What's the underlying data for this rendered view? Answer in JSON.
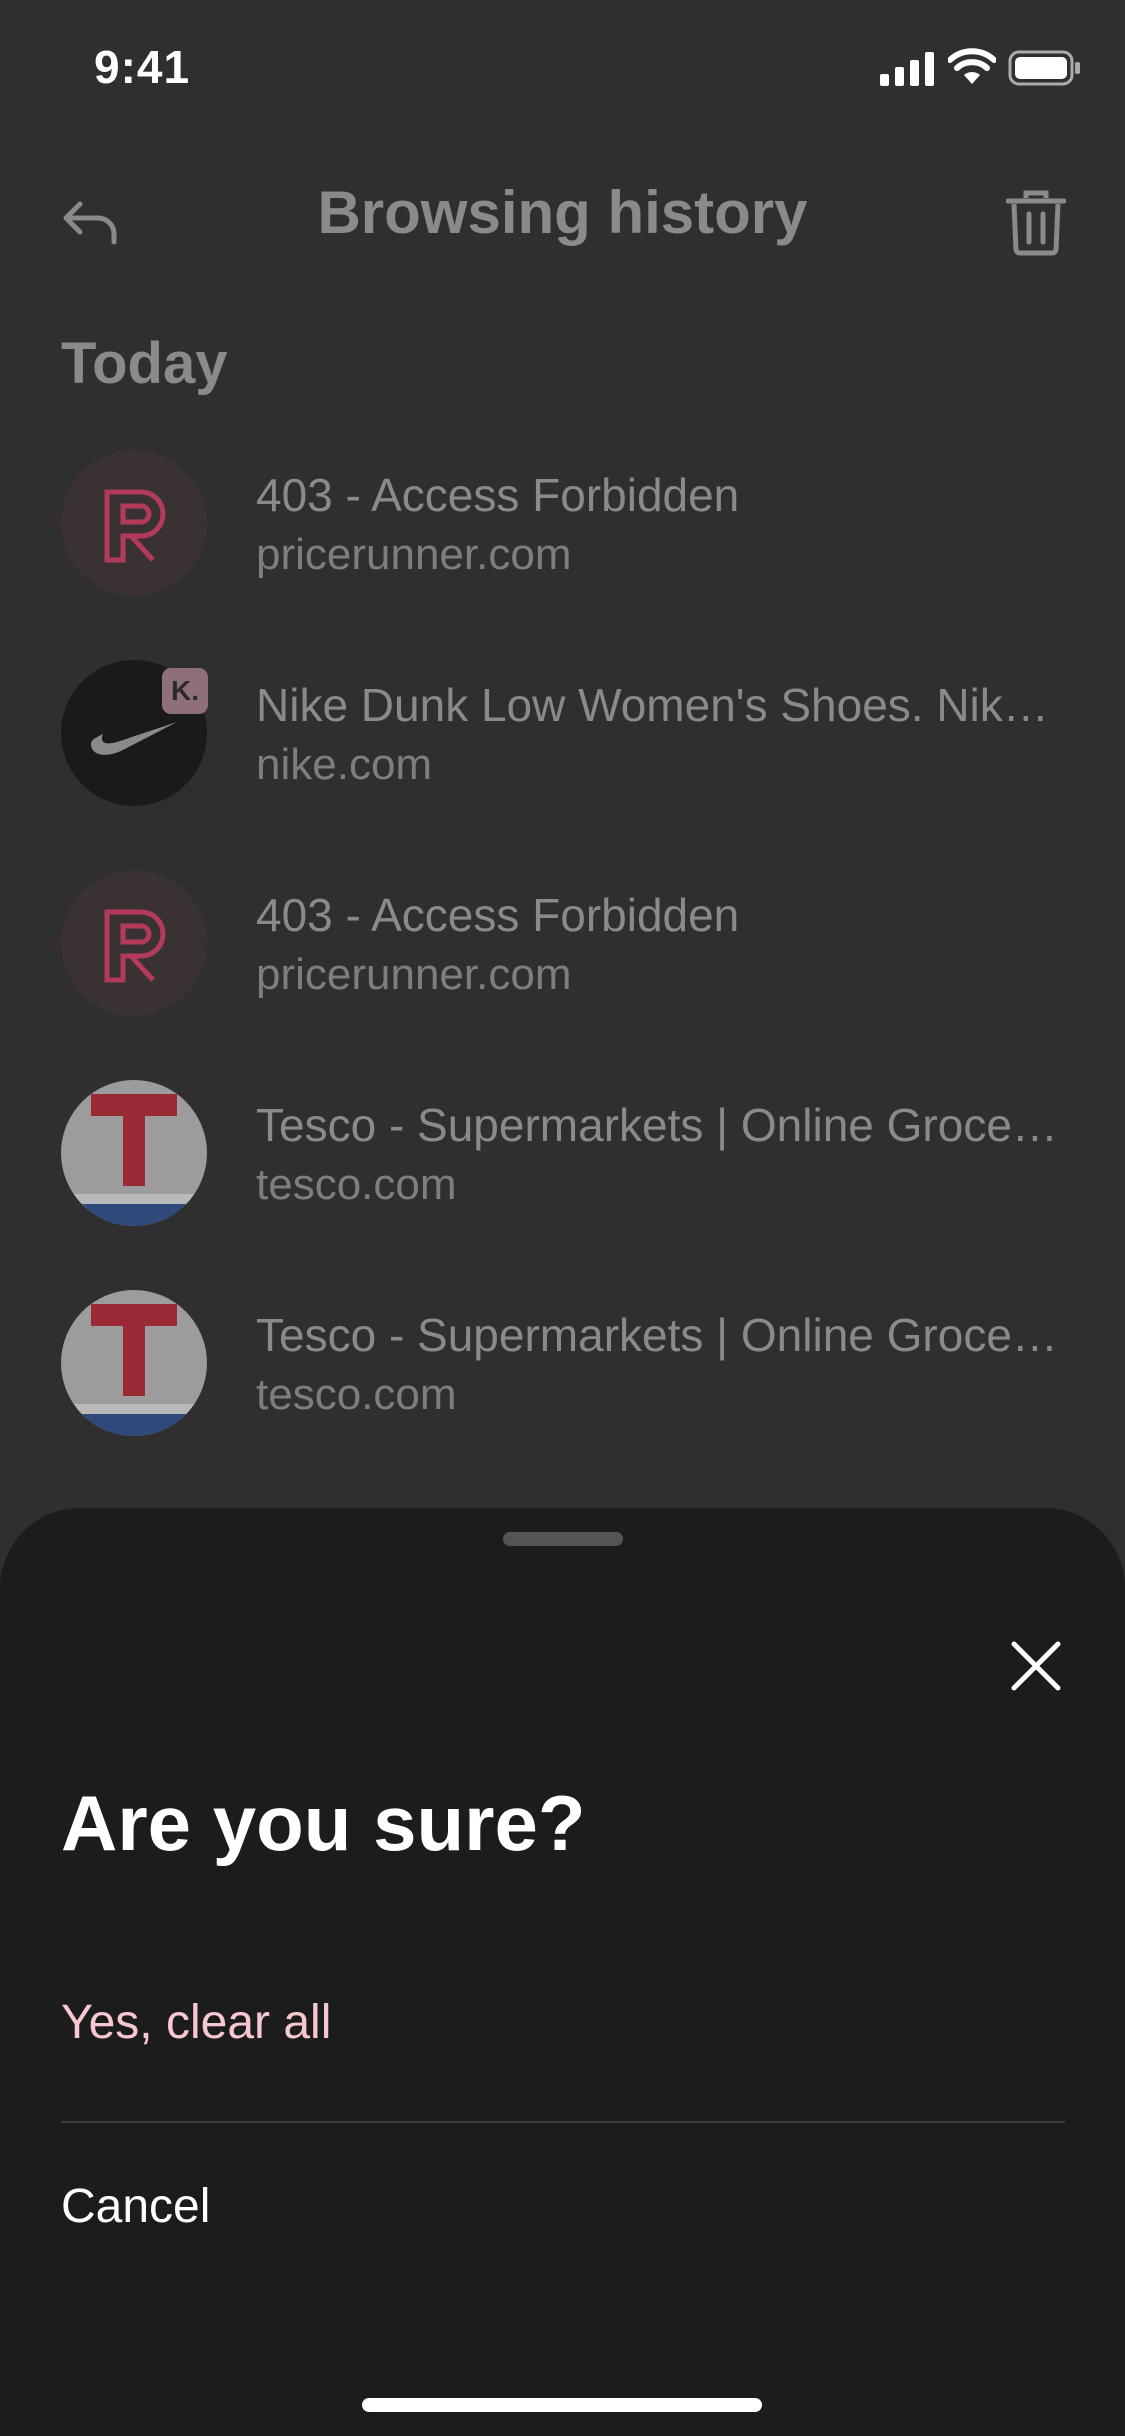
{
  "status_bar": {
    "time": "9:41"
  },
  "header": {
    "title": "Browsing history",
    "back_icon": "back-arrow-icon",
    "delete_icon": "trash-icon"
  },
  "section_label": "Today",
  "history": [
    {
      "title": "403 - Access Forbidden",
      "domain": "pricerunner.com",
      "icon": "pricerunner-logo"
    },
    {
      "title": "Nike Dunk Low Women's Shoes. Nike.com",
      "domain": "nike.com",
      "icon": "nike-logo",
      "badge": "K."
    },
    {
      "title": "403 - Access Forbidden",
      "domain": "pricerunner.com",
      "icon": "pricerunner-logo"
    },
    {
      "title": "Tesco - Supermarkets | Online Groceries",
      "domain": "tesco.com",
      "icon": "tesco-logo"
    },
    {
      "title": "Tesco - Supermarkets | Online Groceries",
      "domain": "tesco.com",
      "icon": "tesco-logo"
    }
  ],
  "sheet": {
    "title": "Are you sure?",
    "confirm_label": "Yes, clear all",
    "cancel_label": "Cancel",
    "close_icon": "close-icon"
  },
  "colors": {
    "confirm": "#f7c9cf",
    "sheet_bg": "#1c1c1c",
    "page_bg": "#2f2f2f"
  }
}
